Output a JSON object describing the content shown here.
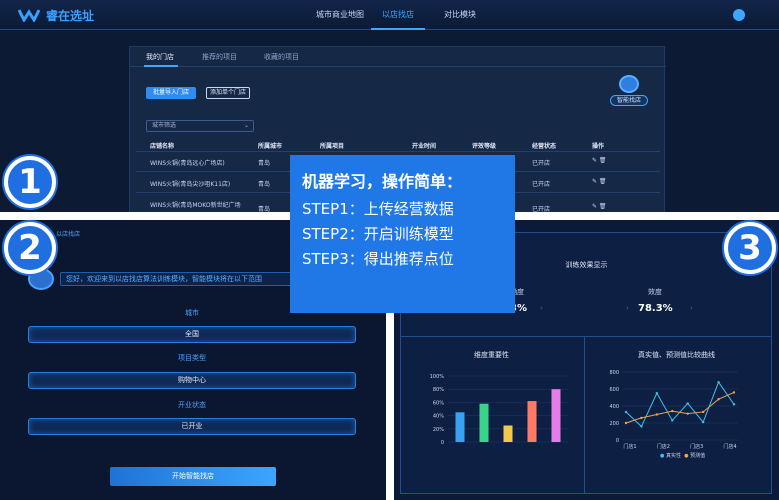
{
  "app": {
    "logo_text": "睿在选址",
    "nav": [
      "城市商业地图",
      "以店找店",
      "对比模块"
    ],
    "active_nav": 1
  },
  "store_card": {
    "tabs": [
      "我的门店",
      "推荐的项目",
      "收藏的项目"
    ],
    "buttons": {
      "bulk_import": "批量导入门店",
      "add_single": "添加单个门店"
    },
    "robot_button": "智能找店",
    "city_filter_placeholder": "城市筛选",
    "columns": [
      "店铺名称",
      "所属城市",
      "所属项目",
      "开业时间",
      "评效等级",
      "经营状态",
      "操作"
    ],
    "rows": [
      {
        "name": "WINS火锅(青岛远心广场店)",
        "city": "青岛",
        "status": "已开店"
      },
      {
        "name": "WINS火锅(青岛尖沙咀K11店)",
        "city": "青岛",
        "status": "已开店"
      },
      {
        "name": "WINS火锅(青岛MOKO新世纪广场",
        "city": "青岛",
        "status": "已开店"
      }
    ]
  },
  "wizard": {
    "corner_text": "以店找店",
    "greeting": "您好，欢迎来到以店找店算法训练模块，智能模块将在以下范围",
    "sections": [
      {
        "label": "城市",
        "value": "全国"
      },
      {
        "label": "项目类型",
        "value": "购物中心"
      },
      {
        "label": "开业状态",
        "value": "已开业"
      }
    ],
    "start_button": "开始智能找店"
  },
  "results": {
    "title": "训练效果显示",
    "metric_left": {
      "label": "确度",
      "value": "3%"
    },
    "metric_right": {
      "label": "效度",
      "value": "78.3%"
    },
    "bar_title": "维度重要性",
    "line_title": "真实值、预测值比较曲线",
    "legend": [
      "真实性",
      "预测值"
    ]
  },
  "overlay": {
    "title": "机器学习，操作简单：",
    "steps": [
      "STEP1：上传经营数据",
      "STEP2：开启训练模型",
      "STEP3：得出推荐点位"
    ]
  },
  "badges": [
    "1",
    "2",
    "3"
  ],
  "chart_data": [
    {
      "type": "bar",
      "title": "维度重要性",
      "ylim": [
        0,
        100
      ],
      "y_ticks": [
        "0",
        "20%",
        "40%",
        "60%",
        "80%",
        "100%"
      ],
      "values": [
        45,
        58,
        25,
        62,
        80
      ],
      "colors": [
        "#3aa0f0",
        "#39d48a",
        "#f2c94c",
        "#ff7a66",
        "#e47de8"
      ]
    },
    {
      "type": "line",
      "title": "真实值、预测值比较曲线",
      "categories": [
        "门店1",
        "门店2",
        "门店3",
        "门店4"
      ],
      "ylim": [
        0,
        800
      ],
      "y_ticks": [
        "0",
        "200",
        "400",
        "600",
        "800"
      ],
      "series": [
        {
          "name": "真实性",
          "color": "#3fc1e8",
          "values": [
            330,
            160,
            550,
            230,
            430,
            210,
            680,
            420
          ]
        },
        {
          "name": "预测值",
          "color": "#f0a24a",
          "values": [
            200,
            260,
            300,
            340,
            310,
            330,
            480,
            560
          ]
        }
      ]
    }
  ]
}
